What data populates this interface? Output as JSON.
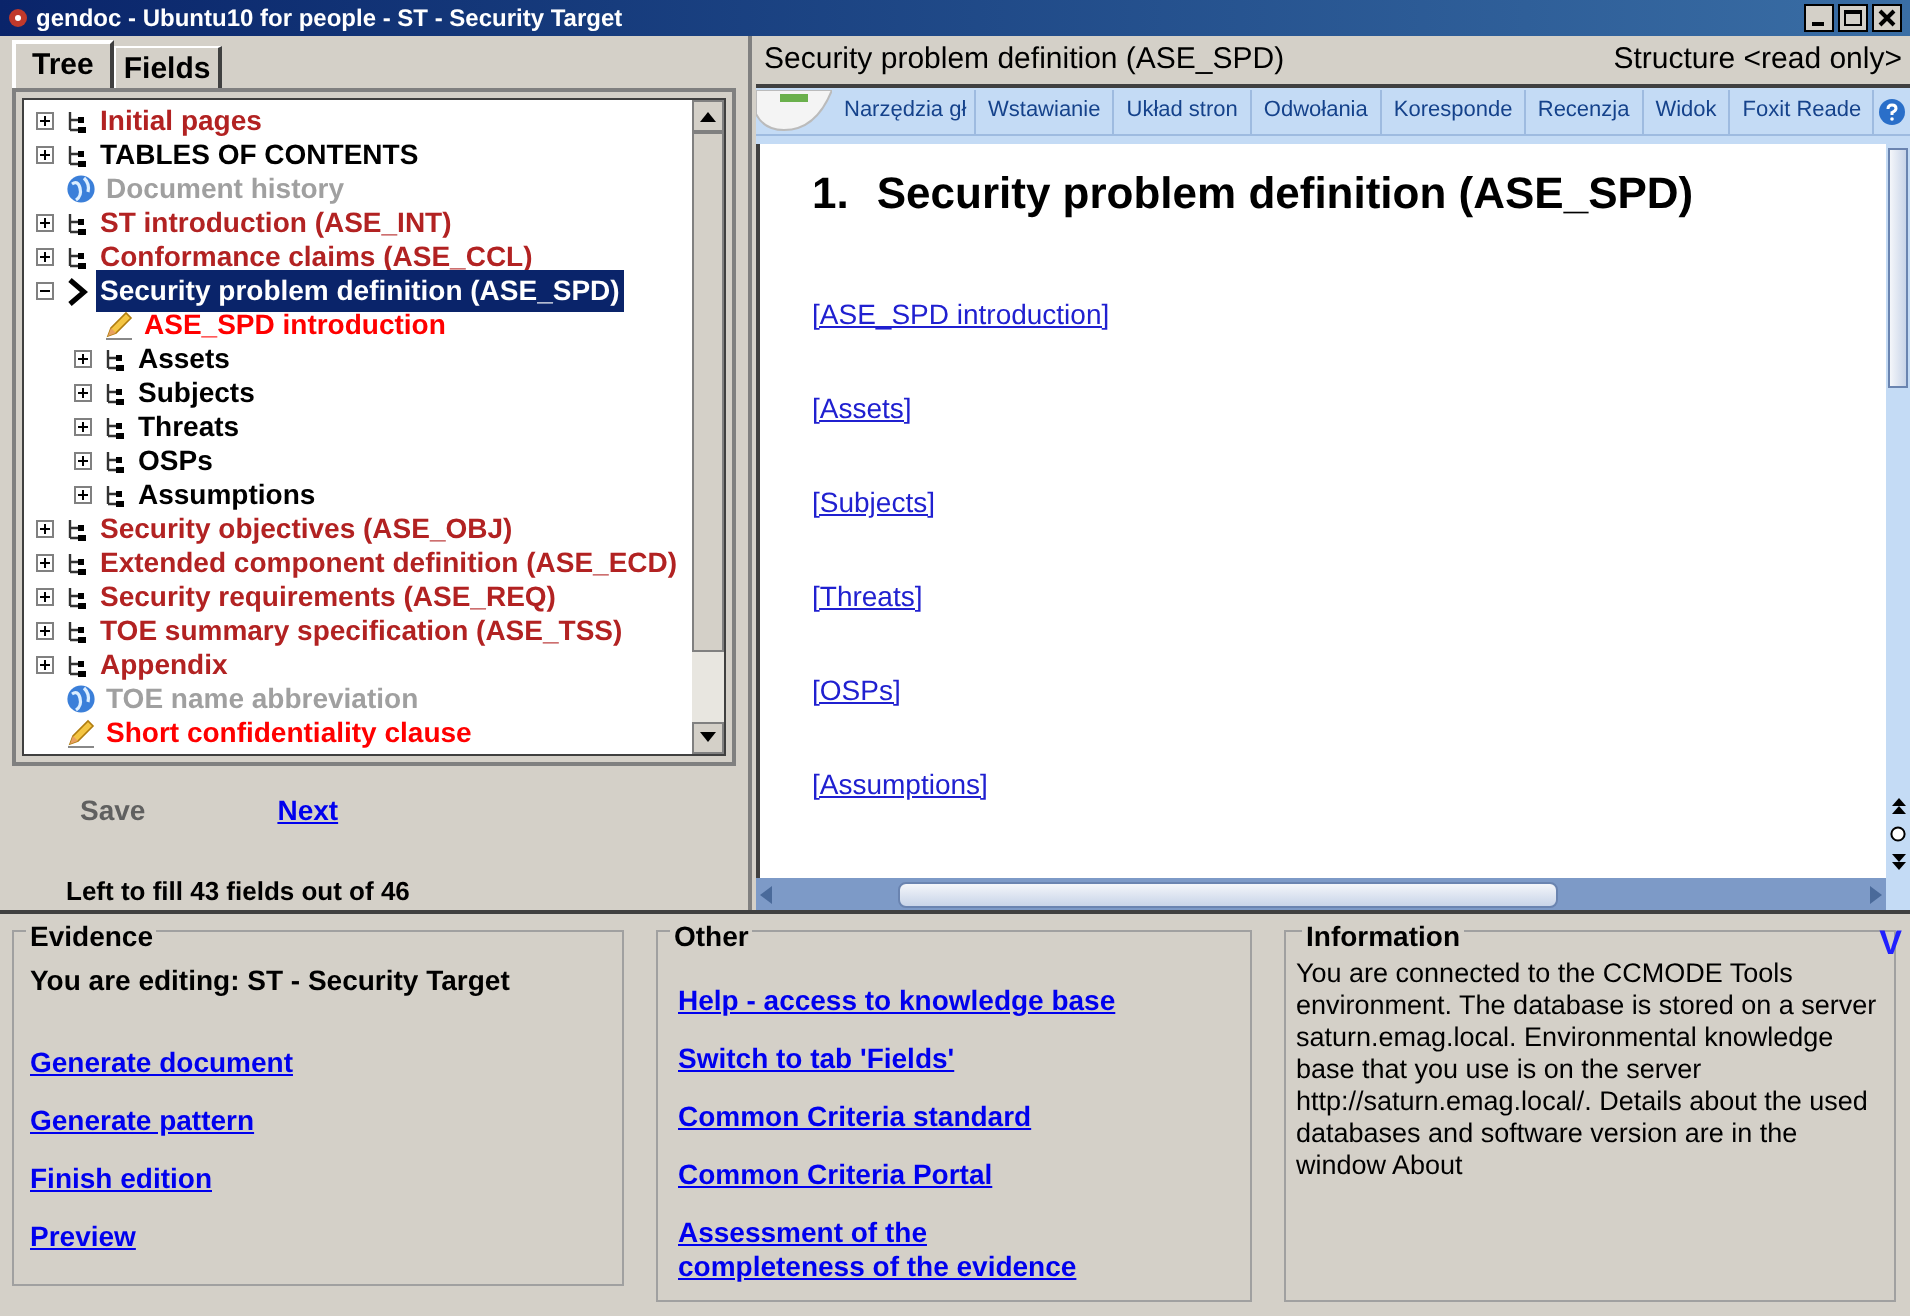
{
  "window": {
    "title": "gendoc -  Ubuntu10 for people - ST - Security Target"
  },
  "left_tabs": [
    {
      "label": "Tree",
      "selected": true
    },
    {
      "label": "Fields",
      "selected": false
    }
  ],
  "tree": [
    {
      "label": "Initial pages",
      "kind": "section",
      "color": "#b22222",
      "expanded": false,
      "selected": false
    },
    {
      "label": "TABLES OF CONTENTS",
      "kind": "section",
      "color": "#000000",
      "expanded": false,
      "selected": false
    },
    {
      "label": "Document history",
      "kind": "info",
      "color": "#a0a0a0",
      "selected": false
    },
    {
      "label": "ST introduction (ASE_INT)",
      "kind": "section",
      "color": "#b22222",
      "expanded": false,
      "selected": false
    },
    {
      "label": "Conformance claims (ASE_CCL)",
      "kind": "section",
      "color": "#b22222",
      "expanded": false,
      "selected": false
    },
    {
      "label": "Security problem definition (ASE_SPD)",
      "kind": "current",
      "expanded": true,
      "selected": true,
      "children": [
        {
          "label": "ASE_SPD introduction",
          "kind": "editable",
          "color": "#ff0000",
          "selected": false
        },
        {
          "label": "Assets",
          "kind": "section",
          "color": "#000000",
          "expanded": false,
          "selected": false
        },
        {
          "label": "Subjects",
          "kind": "section",
          "color": "#000000",
          "expanded": false,
          "selected": false
        },
        {
          "label": "Threats",
          "kind": "section",
          "color": "#000000",
          "expanded": false,
          "selected": false
        },
        {
          "label": "OSPs",
          "kind": "section",
          "color": "#000000",
          "expanded": false,
          "selected": false
        },
        {
          "label": "Assumptions",
          "kind": "section",
          "color": "#000000",
          "expanded": false,
          "selected": false
        }
      ]
    },
    {
      "label": "Security objectives (ASE_OBJ)",
      "kind": "section",
      "color": "#b22222",
      "expanded": false,
      "selected": false
    },
    {
      "label": "Extended component definition (ASE_ECD)",
      "kind": "section",
      "color": "#b22222",
      "expanded": false,
      "selected": false
    },
    {
      "label": "Security requirements (ASE_REQ)",
      "kind": "section",
      "color": "#b22222",
      "expanded": false,
      "selected": false
    },
    {
      "label": "TOE summary specification (ASE_TSS)",
      "kind": "section",
      "color": "#b22222",
      "expanded": false,
      "selected": false
    },
    {
      "label": "Appendix",
      "kind": "section",
      "color": "#b22222",
      "expanded": false,
      "selected": false
    },
    {
      "label": "TOE name abbreviation",
      "kind": "info",
      "color": "#a0a0a0",
      "selected": false
    },
    {
      "label": "Short confidentiality clause",
      "kind": "editable",
      "color": "#ff0000",
      "selected": false
    }
  ],
  "actions": {
    "save": {
      "label": "Save",
      "disabled": true
    },
    "next": {
      "label": "Next"
    }
  },
  "fill_status": "Left to fill 43 fields out of 46",
  "editor": {
    "title": "Security problem definition (ASE_SPD)",
    "mode": "Structure <read only>",
    "ribbon_tabs": [
      "Narzędzia gł",
      "Wstawianie",
      "Układ stron",
      "Odwołania",
      "Koresponde",
      "Recenzja",
      "Widok",
      "Foxit Reade"
    ],
    "heading_number": "1.",
    "heading": "Security problem definition (ASE_SPD)",
    "links": [
      "[ASE_SPD introduction]",
      "[Assets]",
      "[Subjects]",
      "[Threats]",
      "[OSPs]",
      "[Assumptions]"
    ]
  },
  "evidence": {
    "title": "Evidence",
    "editing": "You are editing: ST - Security Target",
    "links": [
      "Generate document",
      "Generate pattern",
      "Finish edition",
      "Preview"
    ]
  },
  "other": {
    "title": "Other",
    "links": [
      "Help - access to knowledge base",
      "Switch to tab 'Fields'",
      "Common Criteria standard",
      "Common Criteria Portal",
      "Assessment of the completeness of the evidence"
    ]
  },
  "information": {
    "title": "Information",
    "text": "You are connected to the CCMODE Tools environment. The database is stored on a server saturn.emag.local. Environmental knowledge base that you use is on the server http://saturn.emag.local/. Details about the used databases and software version are in the window About",
    "corner": "V"
  }
}
